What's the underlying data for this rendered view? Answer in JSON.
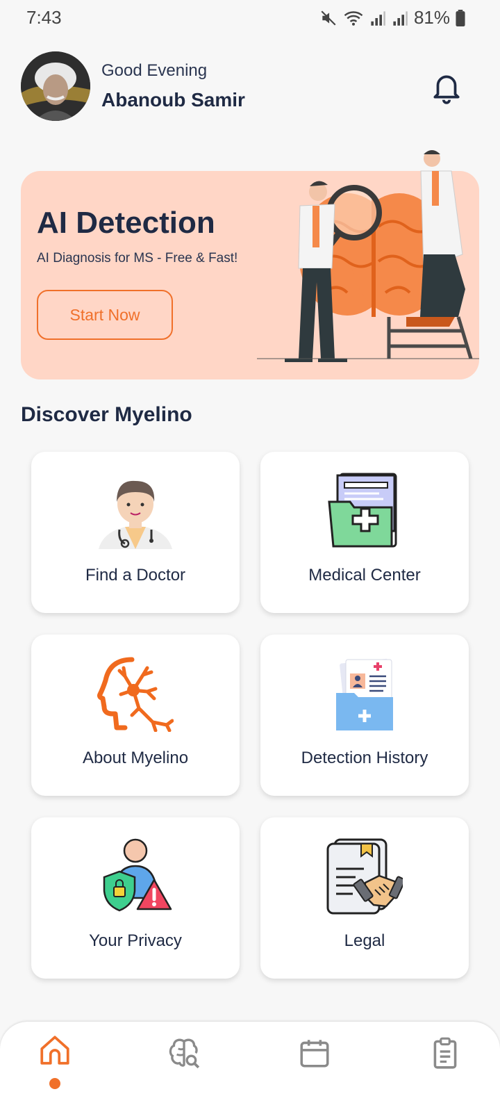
{
  "status": {
    "time": "7:43",
    "battery": "81%"
  },
  "header": {
    "greeting": "Good Evening",
    "user_name": "Abanoub Samir"
  },
  "banner": {
    "title": "AI Detection",
    "subtitle": "AI Diagnosis for MS - Free & Fast!",
    "cta_label": "Start Now"
  },
  "discover": {
    "title": "Discover Myelino",
    "cards": [
      {
        "label": "Find a Doctor",
        "icon": "doctor-icon"
      },
      {
        "label": "Medical Center",
        "icon": "medical-folder-icon"
      },
      {
        "label": "About Myelino",
        "icon": "neuron-head-icon"
      },
      {
        "label": "Detection History",
        "icon": "records-folder-icon"
      },
      {
        "label": "Your Privacy",
        "icon": "privacy-icon"
      },
      {
        "label": "Legal",
        "icon": "legal-handshake-icon"
      }
    ]
  },
  "nav": {
    "items": [
      "home-icon",
      "brain-search-icon",
      "calendar-icon",
      "clipboard-icon"
    ],
    "active": "home-icon"
  },
  "colors": {
    "accent": "#f0702a",
    "banner_bg": "#ffd6c6",
    "text_dark": "#1f2a44"
  }
}
